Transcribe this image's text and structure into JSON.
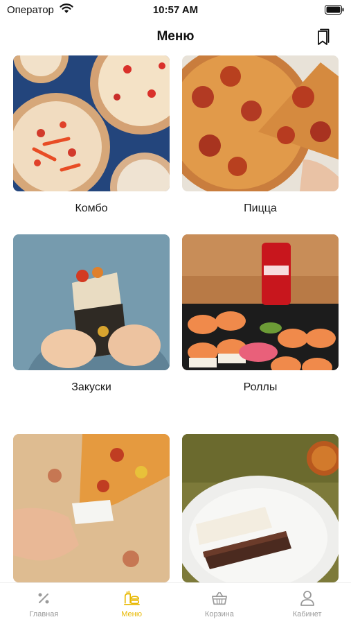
{
  "status_bar": {
    "carrier": "Оператор",
    "time": "10:57 AM"
  },
  "header": {
    "title": "Меню",
    "bookmark_icon": "bookmark-icon"
  },
  "categories": [
    {
      "label": "Комбо",
      "image": "pizza-combo-photo"
    },
    {
      "label": "Пицца",
      "image": "pepperoni-pizza-photo"
    },
    {
      "label": "Закуски",
      "image": "shawarma-wrap-photo"
    },
    {
      "label": "Роллы",
      "image": "sushi-rolls-photo"
    },
    {
      "label": "",
      "image": "pizza-slice-photo"
    },
    {
      "label": "",
      "image": "dessert-cake-photo"
    }
  ],
  "tabbar": {
    "items": [
      {
        "label": "Главная",
        "icon": "percent-icon",
        "active": false
      },
      {
        "label": "Меню",
        "icon": "menu-food-icon",
        "active": true
      },
      {
        "label": "Корзина",
        "icon": "basket-icon",
        "active": false
      },
      {
        "label": "Кабинет",
        "icon": "user-icon",
        "active": false
      }
    ]
  },
  "colors": {
    "accent": "#e8b800",
    "inactive": "#9a9a9a"
  }
}
